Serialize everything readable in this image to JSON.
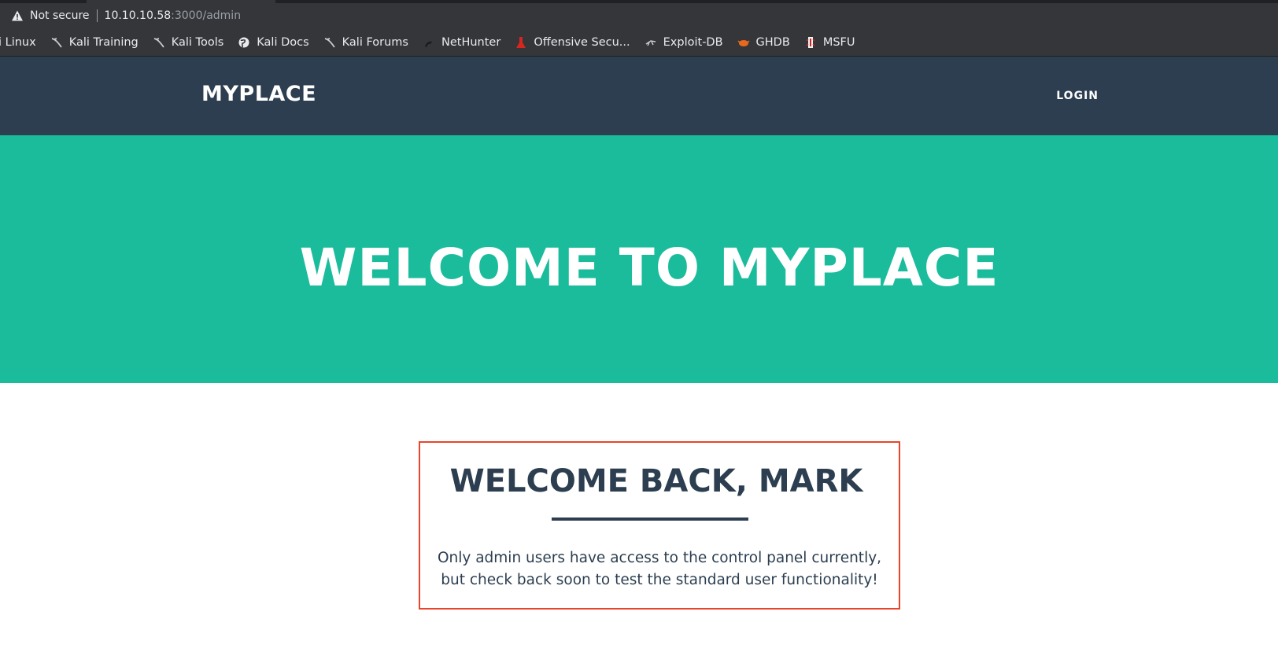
{
  "browser": {
    "security_label": "Not secure",
    "url_host": "10.10.10.58",
    "url_rest": ":3000/admin",
    "bookmarks": [
      {
        "label": "i Linux",
        "icon": "kali-dragon-icon"
      },
      {
        "label": "Kali Training",
        "icon": "kali-dragon-icon"
      },
      {
        "label": "Kali Tools",
        "icon": "kali-dragon-icon"
      },
      {
        "label": "Kali Docs",
        "icon": "globe-icon"
      },
      {
        "label": "Kali Forums",
        "icon": "kali-dragon-icon"
      },
      {
        "label": "NetHunter",
        "icon": "nethunter-icon"
      },
      {
        "label": "Offensive Secu...",
        "icon": "offsec-icon"
      },
      {
        "label": "Exploit-DB",
        "icon": "exploit-db-icon"
      },
      {
        "label": "GHDB",
        "icon": "ghdb-icon"
      },
      {
        "label": "MSFU",
        "icon": "msfu-icon"
      }
    ]
  },
  "nav": {
    "brand": "MYPLACE",
    "login": "LOGIN"
  },
  "hero": {
    "title": "WELCOME TO MYPLACE"
  },
  "welcome": {
    "title": "WELCOME BACK, MARK",
    "text": "Only admin users have access to the control panel currently, but check back soon to test the standard user functionality!"
  },
  "colors": {
    "nav_bg": "#2c3e50",
    "hero_bg": "#1abc9c",
    "highlight_border": "#e8452c"
  }
}
